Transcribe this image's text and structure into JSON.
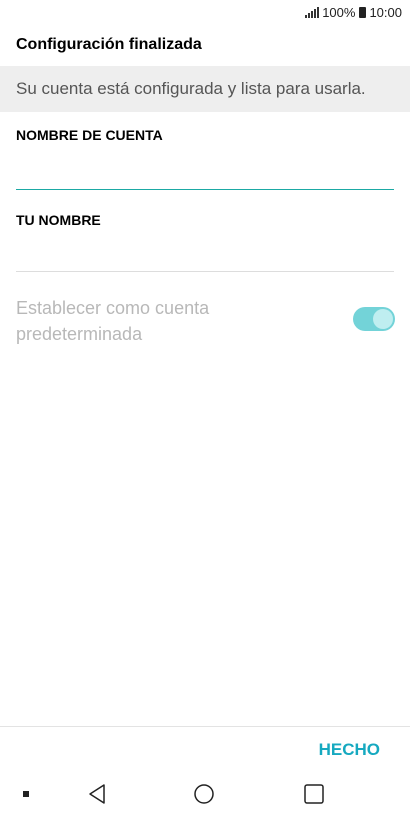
{
  "status_bar": {
    "battery": "100%",
    "time": "10:00",
    "icons": [
      "signal-icon",
      "battery-icon"
    ]
  },
  "header": {
    "title": "Configuración finalizada"
  },
  "banner": {
    "message": "Su cuenta está configurada y lista para usarla."
  },
  "form": {
    "account_name": {
      "label": "NOMBRE DE CUENTA",
      "value": ""
    },
    "your_name": {
      "label": "TU NOMBRE",
      "value": ""
    },
    "default_account": {
      "label": "Establecer como cuenta predeterminada",
      "enabled": true
    }
  },
  "footer": {
    "done_label": "HECHO"
  },
  "nav": {
    "icons": [
      "dot-icon",
      "back-icon",
      "home-icon",
      "recents-icon"
    ]
  },
  "colors": {
    "accent": "#16a9c0",
    "toggle_track": "#73d3d8",
    "banner_bg": "#eeeeee",
    "underline_active": "#1ba9a4"
  }
}
